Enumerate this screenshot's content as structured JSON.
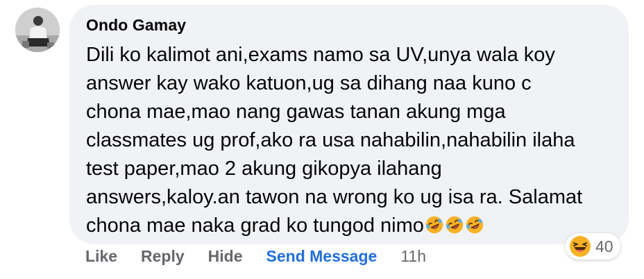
{
  "comment": {
    "author": "Ondo Gamay",
    "lines": [
      "Dili ko kalimot ani,exams namo sa UV,unya wala koy",
      "answer kay wako katuon,ug sa dihang naa kuno c",
      "chona mae,mao nang gawas tanan akung mga",
      "classmates ug prof,ako ra usa nahabilin,nahabilin ilaha",
      "test paper,mao 2 akung gikopya ilahang",
      "answers,kaloy.an tawon na wrong ko ug isa ra. Salamat",
      "chona mae naka grad ko tungod nimo"
    ],
    "trailing_emojis": [
      "rolling-on-floor-laughing-emoji",
      "rolling-on-floor-laughing-emoji",
      "rolling-on-floor-laughing-emoji"
    ]
  },
  "reactions": {
    "icon": "haha-reaction-icon",
    "count": "40"
  },
  "actions": {
    "like": "Like",
    "reply": "Reply",
    "hide": "Hide",
    "send_message": "Send Message",
    "timestamp": "11h"
  },
  "colors": {
    "bubble": "#f0f2f5",
    "text": "#050505",
    "muted": "#65676b",
    "link": "#216fdb",
    "emoji_yellow": "#f7b125"
  }
}
